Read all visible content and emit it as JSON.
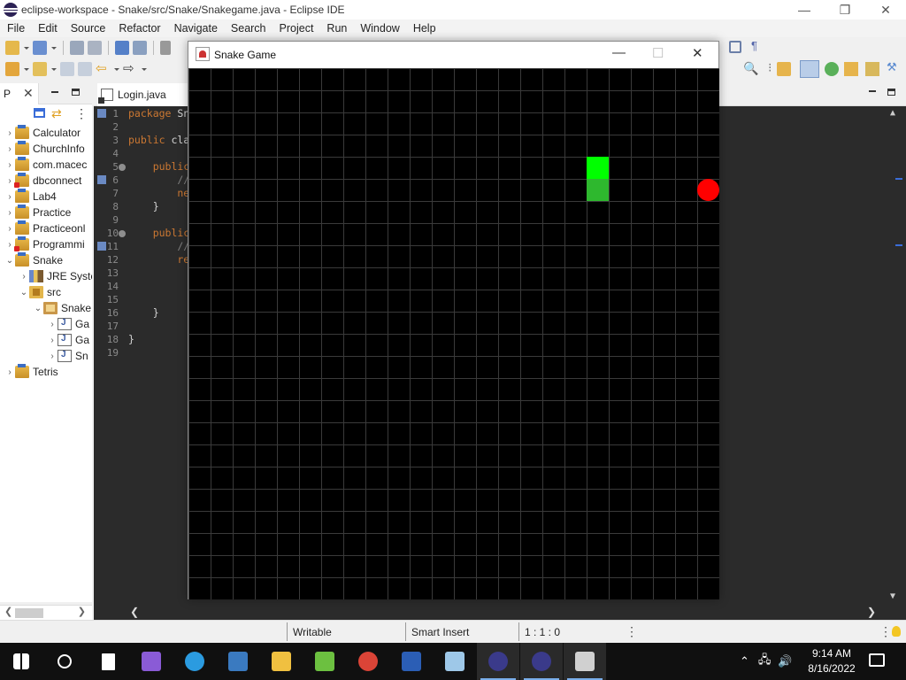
{
  "window": {
    "title": "eclipse-workspace - Snake/src/Snake/Snakegame.java - Eclipse IDE",
    "controls": [
      "—",
      "❐",
      "✕"
    ]
  },
  "menubar": {
    "items": [
      "File",
      "Edit",
      "Source",
      "Refactor",
      "Navigate",
      "Search",
      "Project",
      "Run",
      "Window",
      "Help"
    ]
  },
  "package_explorer": {
    "tab_label": "P",
    "tree": [
      {
        "label": "Calculator",
        "chevron": "›",
        "icon": "project"
      },
      {
        "label": "ChurchInfo",
        "chevron": "›",
        "icon": "project"
      },
      {
        "label": "com.macec",
        "chevron": "›",
        "icon": "project"
      },
      {
        "label": "dbconnect",
        "chevron": "›",
        "icon": "project-error"
      },
      {
        "label": "Lab4",
        "chevron": "›",
        "icon": "project"
      },
      {
        "label": "Practice",
        "chevron": "›",
        "icon": "project"
      },
      {
        "label": "Practiceonl",
        "chevron": "›",
        "icon": "project"
      },
      {
        "label": "Programmi",
        "chevron": "›",
        "icon": "project-error"
      },
      {
        "label": "Snake",
        "chevron": "⌄",
        "icon": "project"
      },
      {
        "label": "JRE Syste",
        "chevron": "›",
        "icon": "library"
      },
      {
        "label": "src",
        "chevron": "⌄",
        "icon": "source-folder"
      },
      {
        "label": "Snake",
        "chevron": "⌄",
        "icon": "package"
      },
      {
        "label": "Ga",
        "chevron": "›",
        "icon": "java-file"
      },
      {
        "label": "Ga",
        "chevron": "›",
        "icon": "java-file"
      },
      {
        "label": "Sn",
        "chevron": "›",
        "icon": "java-file"
      },
      {
        "label": "Tetris",
        "chevron": "›",
        "icon": "project"
      }
    ]
  },
  "editor": {
    "tab_label": "Login.java",
    "line_numbers": [
      "1",
      "2",
      "3",
      "4",
      "5",
      "6",
      "7",
      "8",
      "9",
      "10",
      "11",
      "12",
      "13",
      "14",
      "15",
      "16",
      "17",
      "18",
      "19"
    ],
    "lines": [
      {
        "kw": "package",
        "rest": " Sn"
      },
      {
        "kw": "",
        "rest": ""
      },
      {
        "kw": "public",
        "rest": " cla"
      },
      {
        "kw": "",
        "rest": ""
      },
      {
        "kw": "    public",
        "rest": ""
      },
      {
        "kw": "",
        "rest": "        //"
      },
      {
        "kw": "",
        "rest": "        ne"
      },
      {
        "kw": "",
        "rest": "    }"
      },
      {
        "kw": "",
        "rest": ""
      },
      {
        "kw": "    public",
        "rest": ""
      },
      {
        "kw": "",
        "rest": "        //"
      },
      {
        "kw": "",
        "rest": "        re"
      },
      {
        "kw": "",
        "rest": ""
      },
      {
        "kw": "",
        "rest": ""
      },
      {
        "kw": "",
        "rest": ""
      },
      {
        "kw": "",
        "rest": "    }"
      },
      {
        "kw": "",
        "rest": ""
      },
      {
        "kw": "",
        "rest": "}"
      },
      {
        "kw": "",
        "rest": ""
      }
    ]
  },
  "statusbar": {
    "mode": "Writable",
    "insert": "Smart Insert",
    "position": "1 : 1 : 0"
  },
  "game": {
    "title": "Snake Game",
    "controls": [
      "—",
      "☐",
      "✕"
    ],
    "grid": {
      "columns": 24,
      "rows": 24
    },
    "snake": [
      {
        "col": 18,
        "row": 4,
        "part": "head"
      },
      {
        "col": 18,
        "row": 5,
        "part": "body"
      }
    ],
    "food": {
      "col": 23,
      "row": 5
    },
    "colors": {
      "background": "#000000",
      "grid": "#3a3a3a",
      "head": "#00ff00",
      "body": "#2eb82e",
      "food": "#ff0000"
    }
  },
  "taskbar": {
    "icons": [
      "windows-start-icon",
      "search-icon",
      "file-icon",
      "visual-studio-icon",
      "edge-icon",
      "network-icon",
      "file-explorer-icon",
      "music-icon",
      "chrome-icon",
      "word-icon",
      "paint-icon",
      "eclipse-icon",
      "eclipse-icon",
      "java-app-icon"
    ],
    "time": "9:14 AM",
    "date": "8/16/2022"
  }
}
